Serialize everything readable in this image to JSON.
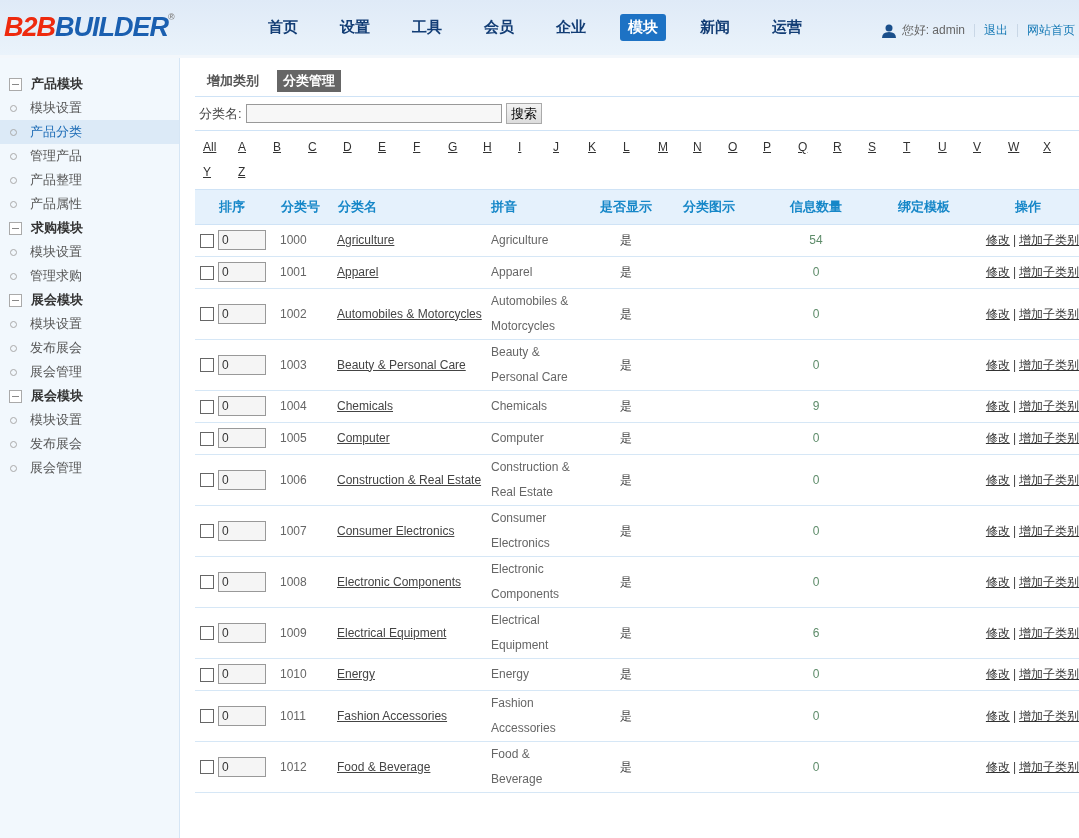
{
  "logo": {
    "red": "B2B",
    "blue": "BUILDER",
    "mark": "®"
  },
  "nav": [
    {
      "label": "首页",
      "selected": false
    },
    {
      "label": "设置",
      "selected": false
    },
    {
      "label": "工具",
      "selected": false
    },
    {
      "label": "会员",
      "selected": false
    },
    {
      "label": "企业",
      "selected": false
    },
    {
      "label": "模块",
      "selected": true
    },
    {
      "label": "新闻",
      "selected": false
    },
    {
      "label": "运营",
      "selected": false
    }
  ],
  "user": {
    "greeting": "您好: admin",
    "links": [
      "退出",
      "网站首页"
    ]
  },
  "sidebar": [
    {
      "title": "产品模块",
      "expanded": true,
      "items": [
        {
          "label": "模块设置",
          "selected": false
        },
        {
          "label": "产品分类",
          "selected": true
        },
        {
          "label": "管理产品",
          "selected": false
        },
        {
          "label": "产品整理",
          "selected": false
        },
        {
          "label": "产品属性",
          "selected": false
        }
      ]
    },
    {
      "title": "求购模块",
      "expanded": true,
      "items": [
        {
          "label": "模块设置",
          "selected": false
        },
        {
          "label": "管理求购",
          "selected": false
        }
      ]
    },
    {
      "title": "展会模块",
      "expanded": true,
      "items": [
        {
          "label": "模块设置",
          "selected": false
        },
        {
          "label": "发布展会",
          "selected": false
        },
        {
          "label": "展会管理",
          "selected": false
        }
      ]
    },
    {
      "title": "展会模块",
      "expanded": true,
      "items": [
        {
          "label": "模块设置",
          "selected": false
        },
        {
          "label": "发布展会",
          "selected": false
        },
        {
          "label": "展会管理",
          "selected": false
        }
      ]
    }
  ],
  "tabs": [
    {
      "label": "增加类别",
      "selected": false
    },
    {
      "label": "分类管理",
      "selected": true
    }
  ],
  "search": {
    "label": "分类名:",
    "button": "搜索"
  },
  "letters": [
    "All",
    "A",
    "B",
    "C",
    "D",
    "E",
    "F",
    "G",
    "H",
    "I",
    "J",
    "K",
    "L",
    "M",
    "N",
    "O",
    "P",
    "Q",
    "R",
    "S",
    "T",
    "U",
    "V",
    "W",
    "X",
    "Y",
    "Z"
  ],
  "table": {
    "columns": [
      "排序",
      "分类号",
      "分类名",
      "拼音",
      "是否显示",
      "分类图示",
      "信息数量",
      "绑定模板",
      "操作"
    ],
    "rows": [
      {
        "checked": false,
        "order": "0",
        "id": "1000",
        "name": "Agriculture",
        "pinyin": "Agriculture",
        "show": "是",
        "count": "54",
        "actions": [
          "修改",
          "增加子类别"
        ],
        "separator": "|"
      },
      {
        "checked": false,
        "order": "0",
        "id": "1001",
        "name": "Apparel",
        "pinyin": "Apparel",
        "show": "是",
        "count": "0",
        "actions": [
          "修改",
          "增加子类别"
        ],
        "separator": "|"
      },
      {
        "checked": false,
        "order": "0",
        "id": "1002",
        "name": "Automobiles & Motorcycles",
        "pinyin": "Automobiles & Motorcycles",
        "show": "是",
        "count": "0",
        "actions": [
          "修改",
          "增加子类别"
        ],
        "separator": "|"
      },
      {
        "checked": false,
        "order": "0",
        "id": "1003",
        "name": "Beauty & Personal Care",
        "pinyin": "Beauty & Personal Care",
        "show": "是",
        "count": "0",
        "actions": [
          "修改",
          "增加子类别"
        ],
        "separator": "|"
      },
      {
        "checked": false,
        "order": "0",
        "id": "1004",
        "name": "Chemicals",
        "pinyin": "Chemicals",
        "show": "是",
        "count": "9",
        "actions": [
          "修改",
          "增加子类别"
        ],
        "separator": "|"
      },
      {
        "checked": false,
        "order": "0",
        "id": "1005",
        "name": "Computer",
        "pinyin": "Computer",
        "show": "是",
        "count": "0",
        "actions": [
          "修改",
          "增加子类别"
        ],
        "separator": "|"
      },
      {
        "checked": false,
        "order": "0",
        "id": "1006",
        "name": "Construction & Real Estate",
        "pinyin": "Construction & Real Estate",
        "show": "是",
        "count": "0",
        "actions": [
          "修改",
          "增加子类别"
        ],
        "separator": "|"
      },
      {
        "checked": false,
        "order": "0",
        "id": "1007",
        "name": "Consumer Electronics",
        "pinyin": "Consumer Electronics",
        "show": "是",
        "count": "0",
        "actions": [
          "修改",
          "增加子类别"
        ],
        "separator": "|"
      },
      {
        "checked": false,
        "order": "0",
        "id": "1008",
        "name": "Electronic Components",
        "pinyin": "Electronic Components",
        "show": "是",
        "count": "0",
        "actions": [
          "修改",
          "增加子类别"
        ],
        "separator": "|"
      },
      {
        "checked": false,
        "order": "0",
        "id": "1009",
        "name": "Electrical Equipment",
        "pinyin": "Electrical Equipment",
        "show": "是",
        "count": "6",
        "actions": [
          "修改",
          "增加子类别"
        ],
        "separator": "|"
      },
      {
        "checked": false,
        "order": "0",
        "id": "1010",
        "name": "Energy",
        "pinyin": "Energy",
        "show": "是",
        "count": "0",
        "actions": [
          "修改",
          "增加子类别"
        ],
        "separator": "|"
      },
      {
        "checked": false,
        "order": "0",
        "id": "1011",
        "name": "Fashion Accessories",
        "pinyin": "Fashion Accessories",
        "show": "是",
        "count": "0",
        "actions": [
          "修改",
          "增加子类别"
        ],
        "separator": "|"
      },
      {
        "checked": false,
        "order": "0",
        "id": "1012",
        "name": "Food & Beverage",
        "pinyin": "Food & Beverage",
        "show": "是",
        "count": "0",
        "actions": [
          "修改",
          "增加子类别"
        ],
        "separator": "|"
      }
    ]
  }
}
